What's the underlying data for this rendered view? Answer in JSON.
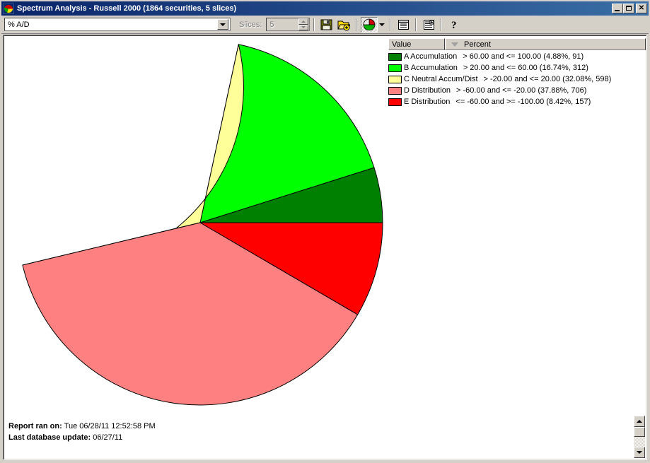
{
  "window": {
    "title": "Spectrum Analysis - Russell 2000 (1864 securities, 5 slices)",
    "app_icon": "pie-chart-icon",
    "minimize_label": "_",
    "maximize_label": "□",
    "close_label": "✕"
  },
  "toolbar": {
    "indicator_combo_value": "% A/D",
    "slices_label": "Slices:",
    "slices_value": "5",
    "buttons": [
      {
        "name": "save-icon",
        "title": "Save"
      },
      {
        "name": "open-add-icon",
        "title": "Open"
      },
      {
        "name": "pie-chart-icon",
        "title": "Pie Chart"
      },
      {
        "name": "chevron-down-icon",
        "title": "Chart Type"
      },
      {
        "name": "report-list-icon",
        "title": "Report"
      },
      {
        "name": "report-add-icon",
        "title": "Add Report"
      },
      {
        "name": "help-icon",
        "title": "Help"
      }
    ]
  },
  "legend": {
    "columns": [
      "Value",
      "Percent"
    ],
    "sort_indicator": "descending",
    "rows": [
      {
        "color": "#008000",
        "name": "A Accumulation",
        "desc": "> 60.00 and <= 100.00 (4.88%, 91)"
      },
      {
        "color": "#00ff00",
        "name": "B Accumulation",
        "desc": "> 20.00 and <= 60.00 (16.74%, 312)"
      },
      {
        "color": "#ffff99",
        "name": "C Neutral Accum/Dist",
        "desc": "> -20.00 and <= 20.00 (32.08%, 598)"
      },
      {
        "color": "#ff8080",
        "name": "D Distribution",
        "desc": "> -60.00 and <= -20.00 (37.88%, 706)"
      },
      {
        "color": "#ff0000",
        "name": "E Distribution",
        "desc": "<= -60.00 and >= -100.00 (8.42%, 157)"
      }
    ]
  },
  "footer": {
    "report_ran_label": "Report ran on:",
    "report_ran_value": "Tue 06/28/11 12:52:58 PM",
    "last_update_label": "Last database update:",
    "last_update_value": "06/27/11"
  },
  "chart_data": {
    "type": "pie",
    "title": "Spectrum Analysis - Russell 2000",
    "total_securities": 1864,
    "slice_count": 5,
    "labels": [
      "A Accumulation",
      "B Accumulation",
      "C Neutral Accum/Dist",
      "D Distribution",
      "E Distribution"
    ],
    "values": [
      4.88,
      16.74,
      32.08,
      37.88,
      8.42
    ],
    "counts": [
      91,
      312,
      598,
      706,
      157
    ],
    "ranges": [
      "> 60.00 and <= 100.00",
      "> 20.00 and <= 60.00",
      "> -20.00 and <= 20.00",
      "> -60.00 and <= -20.00",
      "<= -60.00 and >= -100.00"
    ],
    "colors": [
      "#008000",
      "#00ff00",
      "#ffff99",
      "#ff8080",
      "#ff0000"
    ],
    "center": [
      279,
      327
    ],
    "radius": 258,
    "start_angle_deg": 0,
    "direction": "counterclockwise",
    "legend_position": "right",
    "grid": false
  }
}
